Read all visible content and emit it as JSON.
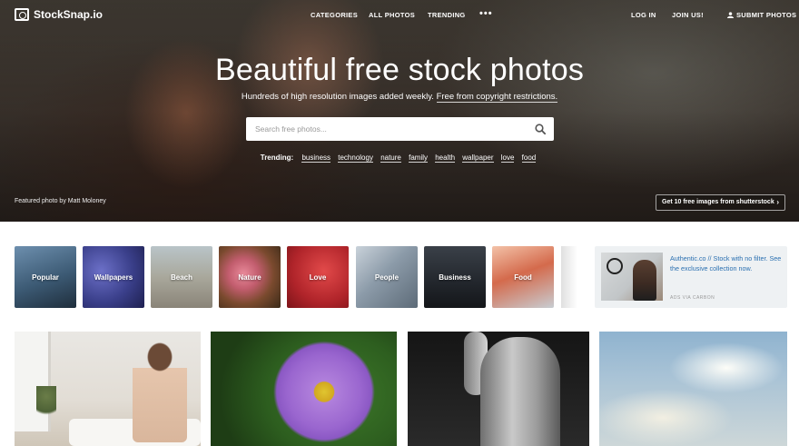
{
  "brand": {
    "name": "StockSnap.io"
  },
  "nav": {
    "categories": "CATEGORIES",
    "all_photos": "ALL PHOTOS",
    "trending": "TRENDING",
    "more": "•••",
    "login": "LOG IN",
    "join": "JOIN US!",
    "submit": "SUBMIT PHOTOS"
  },
  "hero": {
    "title": "Beautiful free stock photos",
    "subtitle_main": "Hundreds of high resolution images added weekly.",
    "subtitle_link": "Free from copyright restrictions.",
    "search_placeholder": "Search free photos...",
    "trending_label": "Trending:",
    "trending_tags": [
      "business",
      "technology",
      "nature",
      "family",
      "health",
      "wallpaper",
      "love",
      "food"
    ],
    "featured_credit": "Featured photo by Matt Moloney",
    "promo_button": "Get 10 free images from shutterstock"
  },
  "categories": [
    {
      "label": "Popular",
      "color": "#3c5a74"
    },
    {
      "label": "Wallpapers",
      "color": "#3a3f8a"
    },
    {
      "label": "Beach",
      "color": "#8a8478"
    },
    {
      "label": "Nature",
      "color": "#7a4a2e"
    },
    {
      "label": "Love",
      "color": "#b0242a"
    },
    {
      "label": "People",
      "color": "#8b9aa8"
    },
    {
      "label": "Business",
      "color": "#22262c"
    },
    {
      "label": "Food",
      "color": "#d46a4c"
    }
  ],
  "ad": {
    "text": "Authentic.co // Stock with no filter. See the exclusive collection now.",
    "via": "ADS VIA CARBON"
  },
  "gallery": [
    {
      "subject": "woman-bathroom-photo"
    },
    {
      "subject": "purple-flower-photo"
    },
    {
      "subject": "jeans-photo"
    },
    {
      "subject": "clouds-sky-photo"
    }
  ]
}
